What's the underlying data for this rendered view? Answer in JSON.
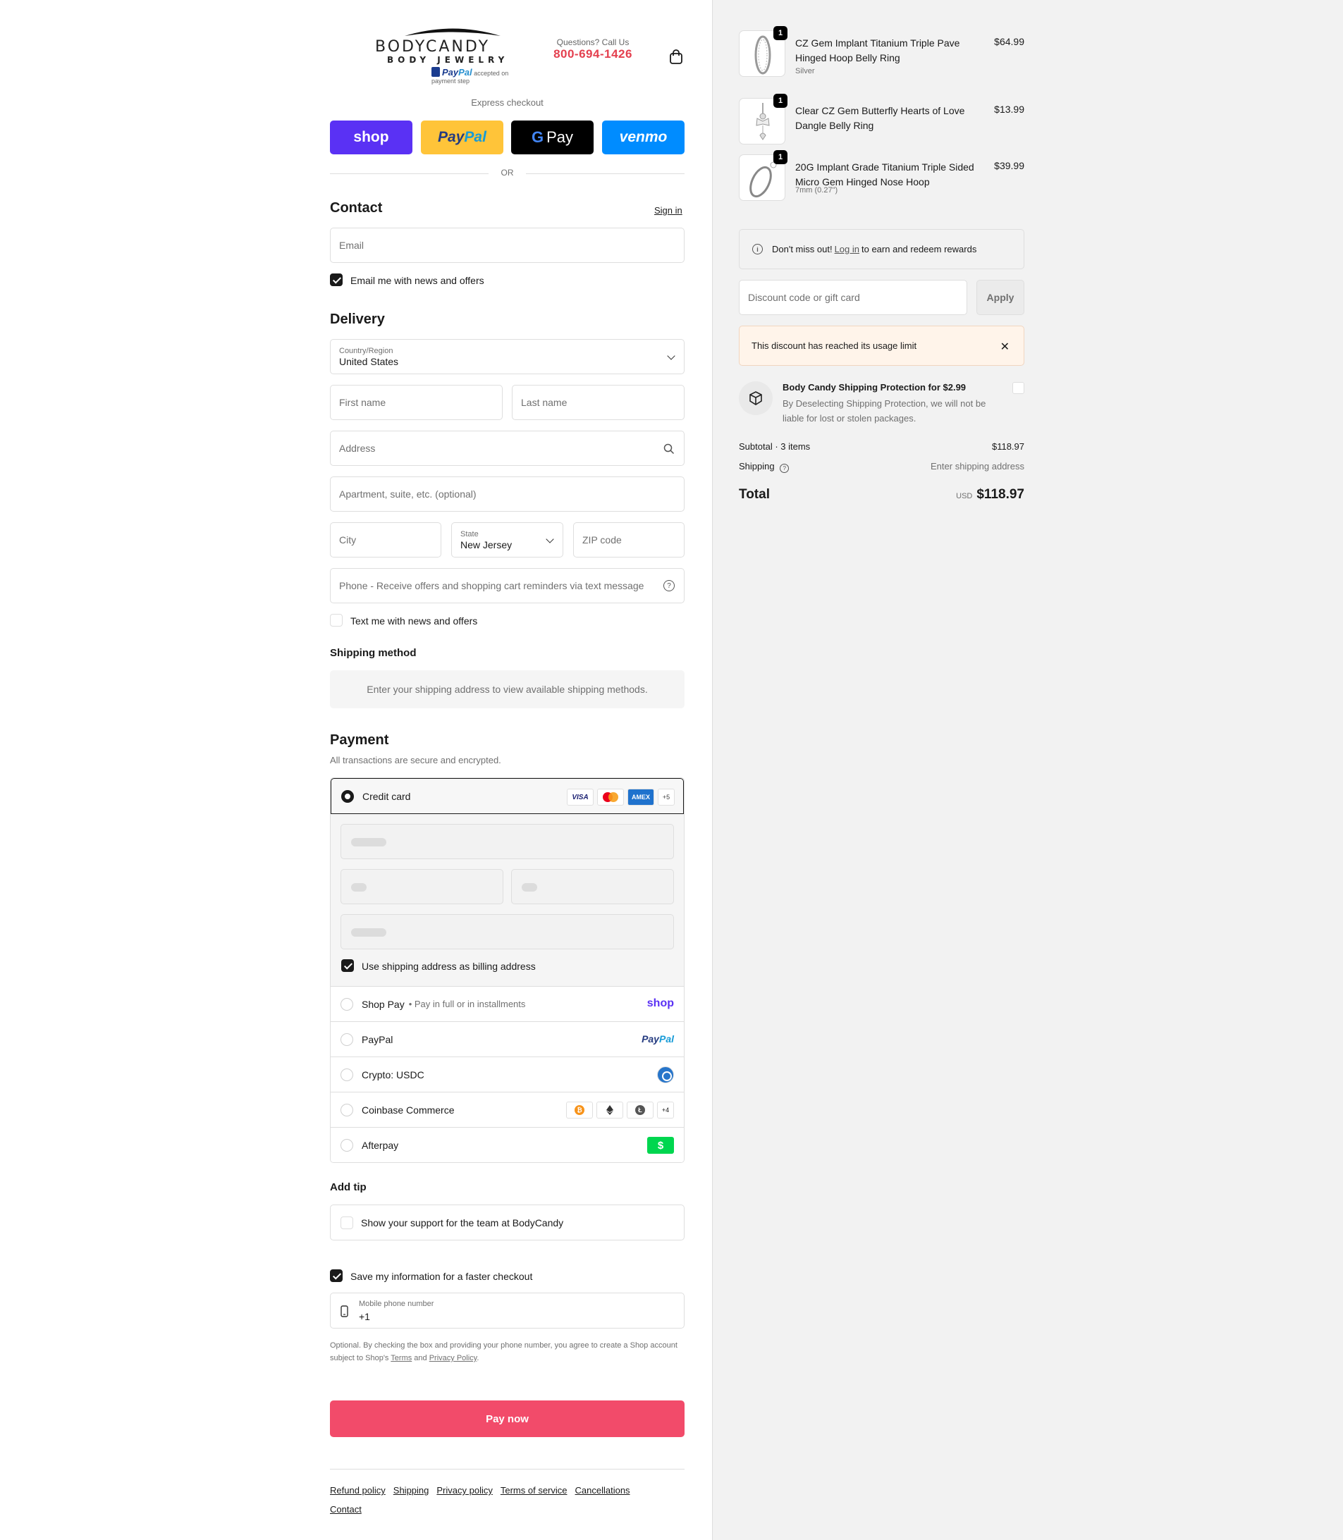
{
  "header": {
    "brand_main": "BODYCANDY",
    "brand_sub": "BODY JEWELRY",
    "paypal_brand_a": "Pay",
    "paypal_brand_b": "Pal",
    "paypal_note": "accepted on payment step",
    "questions_label": "Questions? Call Us",
    "phone": "800-694-1426"
  },
  "express": {
    "title": "Express checkout",
    "shop": "shop",
    "paypal_a": "Pay",
    "paypal_b": "Pal",
    "gpay_g": "G",
    "gpay_label": "Pay",
    "venmo": "venmo",
    "or": "OR"
  },
  "contact": {
    "title": "Contact",
    "sign_in": "Sign in",
    "email_placeholder": "Email",
    "email_opt_in": "Email me with news and offers"
  },
  "delivery": {
    "title": "Delivery",
    "country_label": "Country/Region",
    "country_value": "United States",
    "first_name": "First name",
    "last_name": "Last name",
    "address": "Address",
    "apartment": "Apartment, suite, etc. (optional)",
    "city": "City",
    "state_label": "State",
    "state_value": "New Jersey",
    "zip": "ZIP code",
    "phone": "Phone - Receive offers and shopping cart reminders via text message",
    "text_opt_in": "Text me with news and offers"
  },
  "shipping_method": {
    "title": "Shipping method",
    "note": "Enter your shipping address to view available shipping methods."
  },
  "payment": {
    "title": "Payment",
    "subtitle": "All transactions are secure and encrypted.",
    "credit_card": "Credit card",
    "card_icons": [
      "VISA",
      "AMEX",
      "+5"
    ],
    "billing_same": "Use shipping address as billing address",
    "shop_pay": "Shop Pay",
    "shop_pay_sub": "Pay in full or in installments",
    "shop_logo": "shop",
    "paypal": "PayPal",
    "paypal_logo_a": "Pay",
    "paypal_logo_b": "Pal",
    "crypto": "Crypto: USDC",
    "coinbase": "Coinbase Commerce",
    "coin_more": "+4",
    "afterpay": "Afterpay",
    "afterpay_logo": "$"
  },
  "tip": {
    "title": "Add tip",
    "label": "Show your support for the team at BodyCandy"
  },
  "save_info": {
    "label": "Save my information for a faster checkout",
    "mobile_label": "Mobile phone number",
    "mobile_value": "+1",
    "note_a": "Optional. By checking the box and providing your phone number, you agree to create a Shop account subject to Shop's ",
    "terms": "Terms",
    "and": " and ",
    "privacy": "Privacy Policy",
    "period": "."
  },
  "pay_now": "Pay now",
  "footer": {
    "links": [
      "Refund policy",
      "Shipping",
      "Privacy policy",
      "Terms of service",
      "Cancellations",
      "Contact"
    ]
  },
  "cart": {
    "items": [
      {
        "qty": "1",
        "name": "CZ Gem Implant Titanium Triple Pave Hinged Hoop Belly Ring",
        "variant": "Silver",
        "price": "$64.99"
      },
      {
        "qty": "1",
        "name": "Clear CZ Gem Butterfly Hearts of Love Dangle Belly Ring",
        "variant": "",
        "price": "$13.99"
      },
      {
        "qty": "1",
        "name": "20G Implant Grade Titanium Triple Sided Micro Gem Hinged Nose Hoop",
        "variant": "7mm (0.27\")",
        "price": "$39.99"
      }
    ],
    "rewards_a": "Don't miss out! ",
    "rewards_link": "Log in",
    "rewards_b": " to earn and redeem rewards",
    "discount_placeholder": "Discount code or gift card",
    "apply": "Apply",
    "discount_warning": "This discount has reached its usage limit",
    "protection_title": "Body Candy Shipping Protection for $2.99",
    "protection_desc": "By Deselecting Shipping Protection, we will not be liable for lost or stolen packages.",
    "subtotal_label": "Subtotal · 3 items",
    "subtotal_value": "$118.97",
    "shipping_label": "Shipping",
    "shipping_value": "Enter shipping address",
    "total_label": "Total",
    "currency": "USD",
    "total_value": "$118.97"
  },
  "colors": {
    "accent": "#f24b6a",
    "phone": "#e4404f",
    "shop": "#5a31f4",
    "paypal_yellow": "#ffc439",
    "venmo": "#008cff"
  }
}
